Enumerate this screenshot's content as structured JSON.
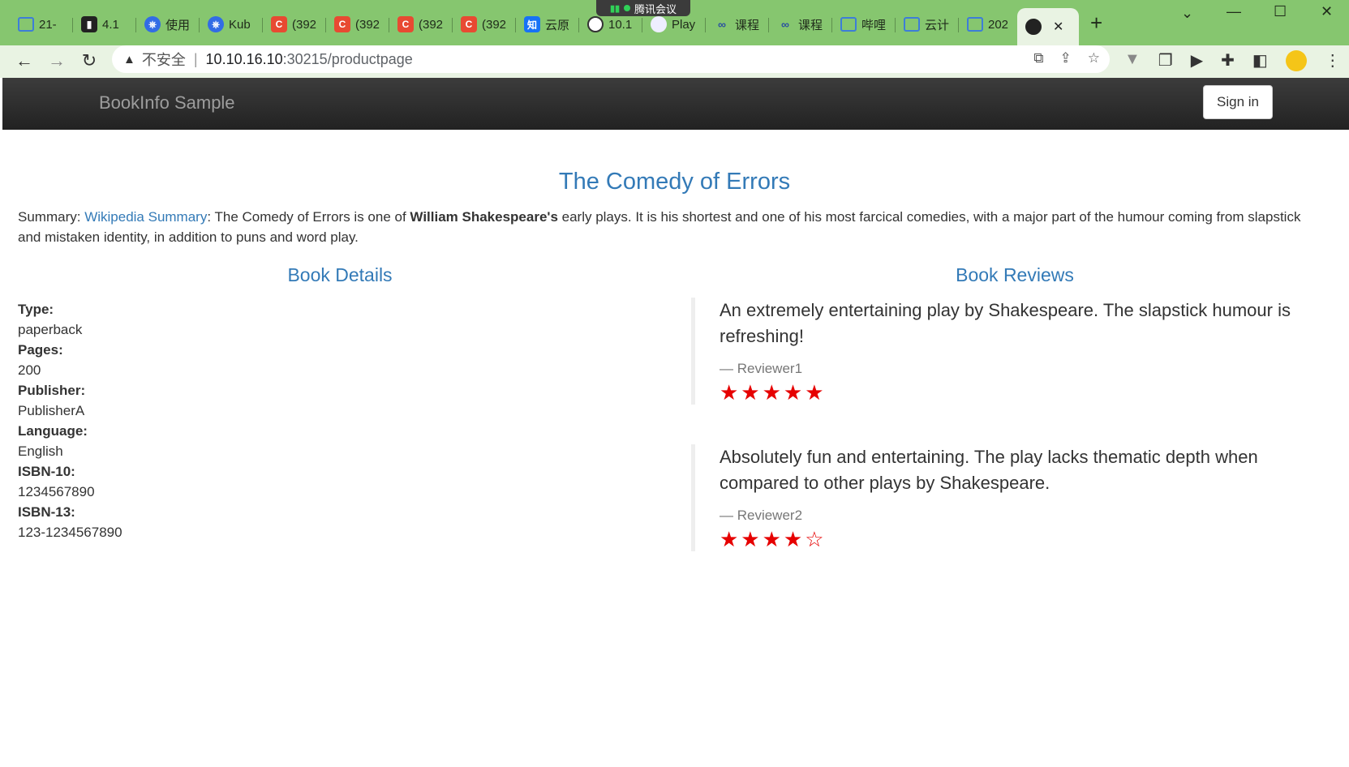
{
  "browser": {
    "tabs": [
      {
        "icon": "calendar-icon",
        "label": "21-"
      },
      {
        "icon": "book-icon",
        "label": "4.1"
      },
      {
        "icon": "kubernetes-icon",
        "label": "使用"
      },
      {
        "icon": "kubernetes-icon",
        "label": "Kub"
      },
      {
        "icon": "csdn-icon",
        "label": "(392"
      },
      {
        "icon": "csdn-icon",
        "label": "(392"
      },
      {
        "icon": "csdn-icon",
        "label": "(392"
      },
      {
        "icon": "csdn-icon",
        "label": "(392"
      },
      {
        "icon": "zhihu-icon",
        "label": "云原"
      },
      {
        "icon": "github-icon",
        "label": "10.1"
      },
      {
        "icon": "play-icon",
        "label": "Play"
      },
      {
        "icon": "link-icon",
        "label": "课程"
      },
      {
        "icon": "link-icon",
        "label": "课程"
      },
      {
        "icon": "calendar-icon",
        "label": "哔哩"
      },
      {
        "icon": "calendar-icon",
        "label": "云计"
      },
      {
        "icon": "calendar-icon",
        "label": "202"
      }
    ],
    "meeting_label": "腾讯会议",
    "address": {
      "insecure_label": "不安全",
      "host": "10.10.16.10",
      "path": ":30215/productpage"
    }
  },
  "page": {
    "brand": "BookInfo Sample",
    "signin_label": "Sign in",
    "title": "The Comedy of Errors",
    "summary": {
      "prefix": "Summary: ",
      "link": "Wikipedia Summary",
      "text1": ": The Comedy of Errors is one of ",
      "bold": "William Shakespeare's",
      "text2": " early plays. It is his shortest and one of his most farcical comedies, with a major part of the humour coming from slapstick and mistaken identity, in addition to puns and word play."
    },
    "details_title": "Book Details",
    "details": [
      {
        "key": "Type:",
        "value": "paperback"
      },
      {
        "key": "Pages:",
        "value": "200"
      },
      {
        "key": "Publisher:",
        "value": "PublisherA"
      },
      {
        "key": "Language:",
        "value": "English"
      },
      {
        "key": "ISBN-10:",
        "value": "1234567890"
      },
      {
        "key": "ISBN-13:",
        "value": "123-1234567890"
      }
    ],
    "reviews_title": "Book Reviews",
    "reviews": [
      {
        "text": "An extremely entertaining play by Shakespeare. The slapstick humour is refreshing!",
        "reviewer": "— Reviewer1",
        "rating": 5,
        "stars": "★★★★★"
      },
      {
        "text": "Absolutely fun and entertaining. The play lacks thematic depth when compared to other plays by Shakespeare.",
        "reviewer": "— Reviewer2",
        "rating": 4,
        "stars": "★★★★☆"
      }
    ],
    "star_color": "#e60000",
    "link_color": "#337ab7"
  }
}
